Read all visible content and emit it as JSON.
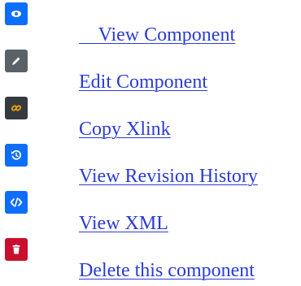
{
  "actions": [
    {
      "icon": "eye-icon",
      "label": "    View Component",
      "color": "#0d6efd"
    },
    {
      "icon": "pencil-icon",
      "label": "Edit Component",
      "color": "#5a6268"
    },
    {
      "icon": "link-icon",
      "label": "Copy Xlink",
      "color": "#343a40"
    },
    {
      "icon": "history-icon",
      "label": "View Revision History",
      "color": "#0d6efd"
    },
    {
      "icon": "code-icon",
      "label": "View XML",
      "color": "#0d6efd"
    },
    {
      "icon": "trash-icon",
      "label": "Delete this component",
      "color": "#c8102e"
    }
  ]
}
